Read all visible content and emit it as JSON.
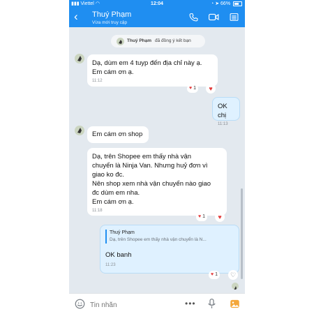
{
  "status_bar": {
    "carrier": "Viettel",
    "time": "12:04",
    "battery": "66%",
    "battery_level": 0.66
  },
  "header": {
    "contact_name": "Thuý Phạm",
    "presence": "Vừa mới truy cập"
  },
  "system_message": {
    "name": "Thuý Phạm",
    "text": "đã đồng ý kết bạn"
  },
  "messages": [
    {
      "sender": "contact",
      "lines": [
        "Dạ, dùm em 4 tuyp đến địa chỉ này ạ.",
        "Em cám ơn ạ."
      ],
      "time": "11:12",
      "reaction_count": "1"
    },
    {
      "sender": "me",
      "lines": [
        "OK chị"
      ],
      "time": "11:13"
    },
    {
      "sender": "contact",
      "lines": [
        "Em cám ơn shop"
      ]
    },
    {
      "sender": "contact",
      "lines": [
        "Dạ, trên Shopee em thấy nhà vận",
        "chuyển là Ninja Van. Nhưng huỷ đơn vì",
        "giao ko đc.",
        "Nên shop xem nhà vận chuyển nào giao",
        "đc dùm em nha.",
        "Em cám ơn ạ."
      ],
      "time": "11:18",
      "reaction_count": "1"
    },
    {
      "sender": "me",
      "quote": {
        "name": "Thuý Phạm",
        "text": "Dạ, trên Shopee em thấy nhà vận chuyển là N..."
      },
      "lines": [
        "OK banh"
      ],
      "time": "11:23",
      "reaction_count": "1"
    }
  ],
  "input": {
    "placeholder": "Tin nhắn"
  },
  "colors": {
    "accent": "#1f8ef1",
    "chat_bg": "#e3e9ef",
    "my_bubble": "#dff1ff",
    "heart": "#e23a3a"
  }
}
